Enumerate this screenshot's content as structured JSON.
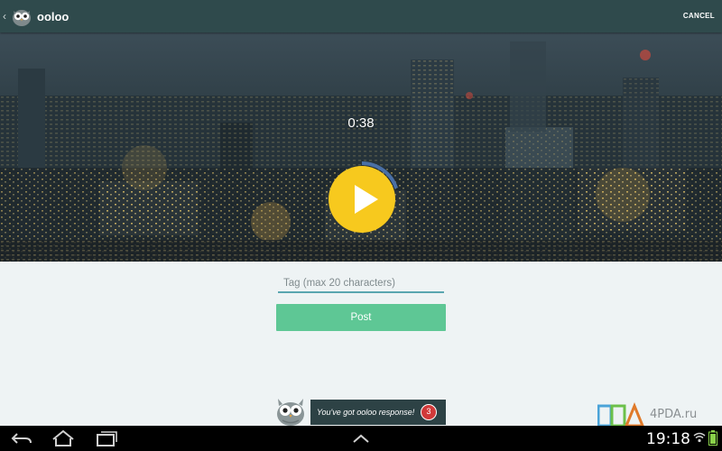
{
  "app": {
    "title": "ooloo",
    "cancel_label": "CANCEL"
  },
  "player": {
    "time_remaining": "0:38",
    "progress_fraction": 0.2,
    "ring_color": "#4a6fa5",
    "button_color": "#f7c91e"
  },
  "form": {
    "tag_placeholder": "Tag (max 20 characters)",
    "tag_value": "",
    "post_label": "Post",
    "post_color": "#5ec795"
  },
  "notification": {
    "text": "You've got ooloo response!",
    "badge_count": "3"
  },
  "watermark": {
    "text": "4PDA.ru"
  },
  "system_bar": {
    "time": "19:18",
    "icons": [
      "back-icon",
      "home-icon",
      "recent-apps-icon",
      "chevron-up-icon",
      "gallery-icon",
      "wifi-icon",
      "battery-icon"
    ]
  }
}
